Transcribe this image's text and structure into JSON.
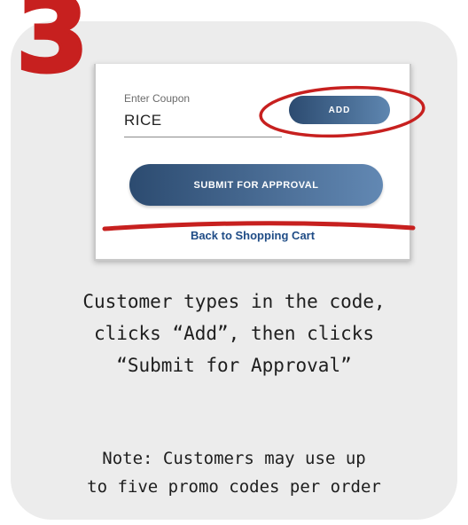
{
  "step": {
    "number": "3",
    "accent_color": "#c7201f"
  },
  "screenshot": {
    "coupon_label": "Enter Coupon",
    "coupon_value": "RICE",
    "add_label": "ADD",
    "submit_label": "SUBMIT FOR APPROVAL",
    "back_label": "Back to Shopping Cart",
    "button_color": "#2c4b70",
    "link_color": "#1f4c86"
  },
  "caption": {
    "lines": [
      "Customer types in the code,",
      "clicks “Add”, then clicks",
      "“Submit for Approval”"
    ]
  },
  "note": {
    "lines": [
      "Note: Customers may use up",
      "to five promo codes per order"
    ]
  }
}
